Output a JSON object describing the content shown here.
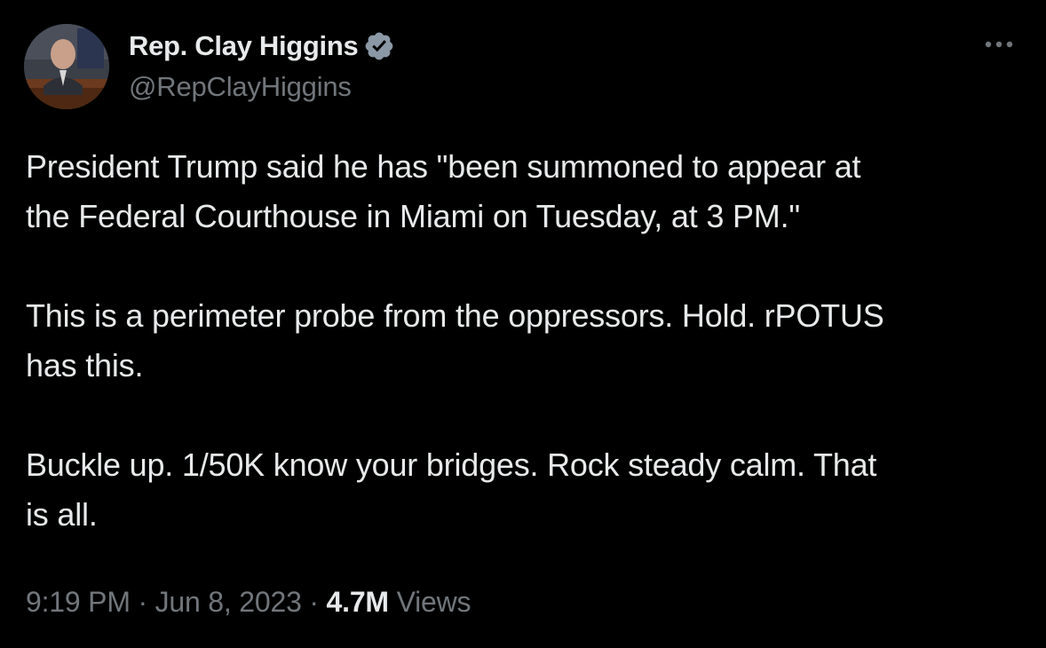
{
  "author": {
    "display_name": "Rep. Clay Higgins",
    "handle": "@RepClayHiggins",
    "verified_icon": "verified-badge-icon",
    "verified_color": "#8b98a5"
  },
  "menu": {
    "icon": "more-horizontal-icon"
  },
  "tweet": {
    "paragraphs": [
      "President Trump said he has \"been summoned to appear at\nthe Federal Courthouse in Miami on Tuesday, at 3 PM.\"",
      "This is a perimeter probe from the oppressors. Hold. rPOTUS\nhas this.",
      "Buckle up. 1/50K know your bridges. Rock steady calm. That\nis all."
    ]
  },
  "meta": {
    "time": "9:19 PM",
    "separator": " · ",
    "date": "Jun 8, 2023",
    "views_count": "4.7M",
    "views_label": "Views"
  },
  "colors": {
    "background": "#000000",
    "primary_text": "#e7e9ea",
    "secondary_text": "#71767b"
  }
}
